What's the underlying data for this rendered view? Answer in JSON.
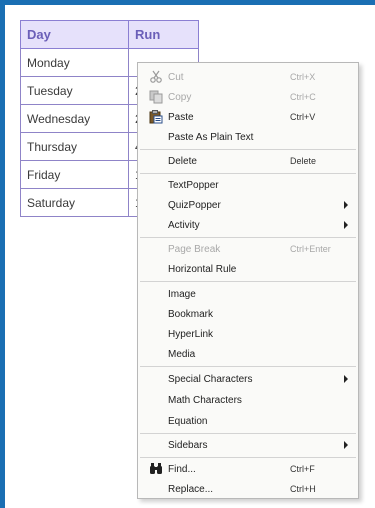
{
  "table": {
    "headers": [
      "Day",
      "Run"
    ],
    "rows": [
      {
        "day": "Monday",
        "run": ""
      },
      {
        "day": "Tuesday",
        "run": "2"
      },
      {
        "day": "Wednesday",
        "run": "2"
      },
      {
        "day": "Thursday",
        "run": "4"
      },
      {
        "day": "Friday",
        "run": "1"
      },
      {
        "day": "Saturday",
        "run": "1"
      }
    ]
  },
  "menu": {
    "cut": {
      "label": "Cut",
      "shortcut": "Ctrl+X"
    },
    "copy": {
      "label": "Copy",
      "shortcut": "Ctrl+C"
    },
    "paste": {
      "label": "Paste",
      "shortcut": "Ctrl+V"
    },
    "paste_plain": {
      "label": "Paste As Plain Text"
    },
    "delete": {
      "label": "Delete",
      "shortcut": "Delete"
    },
    "textpopper": {
      "label": "TextPopper"
    },
    "quizpopper": {
      "label": "QuizPopper"
    },
    "activity": {
      "label": "Activity"
    },
    "page_break": {
      "label": "Page Break",
      "shortcut": "Ctrl+Enter"
    },
    "horizontal_rule": {
      "label": "Horizontal Rule"
    },
    "image": {
      "label": "Image"
    },
    "bookmark": {
      "label": "Bookmark"
    },
    "hyperlink": {
      "label": "HyperLink"
    },
    "media": {
      "label": "Media"
    },
    "special_characters": {
      "label": "Special Characters"
    },
    "math_characters": {
      "label": "Math Characters"
    },
    "equation": {
      "label": "Equation"
    },
    "sidebars": {
      "label": "Sidebars"
    },
    "find": {
      "label": "Find...",
      "shortcut": "Ctrl+F"
    },
    "replace": {
      "label": "Replace...",
      "shortcut": "Ctrl+H"
    }
  },
  "colors": {
    "frame": "#1a6fb3",
    "table_header_bg": "#e6e1fb",
    "table_border": "#8f84c8"
  },
  "icons": {
    "cut": "scissors-icon",
    "copy": "copy-icon",
    "paste": "clipboard-icon",
    "find": "binoculars-icon"
  }
}
